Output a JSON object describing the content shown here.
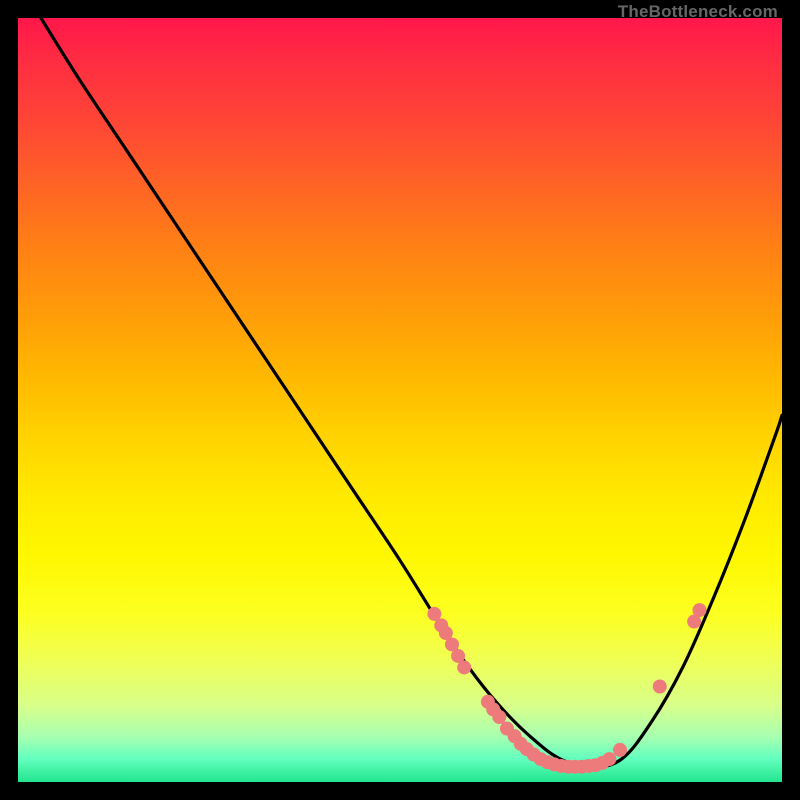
{
  "watermark": "TheBottleneck.com",
  "chart_data": {
    "type": "line",
    "title": "",
    "xlabel": "",
    "ylabel": "",
    "xlim": [
      0,
      100
    ],
    "ylim": [
      0,
      100
    ],
    "grid": false,
    "series": [
      {
        "name": "curve",
        "x": [
          3,
          8,
          14,
          20,
          26,
          32,
          38,
          44,
          50,
          55,
          59,
          63,
          67,
          71,
          75,
          79,
          83,
          87,
          91,
          95,
          99,
          100
        ],
        "y": [
          100,
          92,
          83,
          74,
          65,
          56,
          47,
          38,
          29,
          21,
          15,
          10,
          6,
          3,
          2,
          3,
          8,
          15,
          24,
          34,
          45,
          48
        ],
        "color": "#000000"
      }
    ],
    "markers": [
      {
        "x": 54.5,
        "y": 22.0
      },
      {
        "x": 55.4,
        "y": 20.5
      },
      {
        "x": 56.0,
        "y": 19.5
      },
      {
        "x": 56.8,
        "y": 18.0
      },
      {
        "x": 57.6,
        "y": 16.5
      },
      {
        "x": 58.4,
        "y": 15.0
      },
      {
        "x": 61.5,
        "y": 10.5
      },
      {
        "x": 62.2,
        "y": 9.5
      },
      {
        "x": 63.0,
        "y": 8.5
      },
      {
        "x": 64.0,
        "y": 7.0
      },
      {
        "x": 65.0,
        "y": 6.0
      },
      {
        "x": 65.8,
        "y": 5.0
      },
      {
        "x": 66.6,
        "y": 4.3
      },
      {
        "x": 67.5,
        "y": 3.6
      },
      {
        "x": 68.4,
        "y": 3.0
      },
      {
        "x": 69.3,
        "y": 2.6
      },
      {
        "x": 70.2,
        "y": 2.3
      },
      {
        "x": 71.1,
        "y": 2.1
      },
      {
        "x": 72.0,
        "y": 2.0
      },
      {
        "x": 72.9,
        "y": 2.0
      },
      {
        "x": 73.8,
        "y": 2.0
      },
      {
        "x": 74.7,
        "y": 2.1
      },
      {
        "x": 75.6,
        "y": 2.2
      },
      {
        "x": 76.5,
        "y": 2.5
      },
      {
        "x": 77.4,
        "y": 3.0
      },
      {
        "x": 78.8,
        "y": 4.2
      },
      {
        "x": 84.0,
        "y": 12.5
      },
      {
        "x": 88.5,
        "y": 21.0
      },
      {
        "x": 89.2,
        "y": 22.5
      }
    ],
    "marker_color": "#ed7b7b",
    "marker_radius_px": 7
  }
}
